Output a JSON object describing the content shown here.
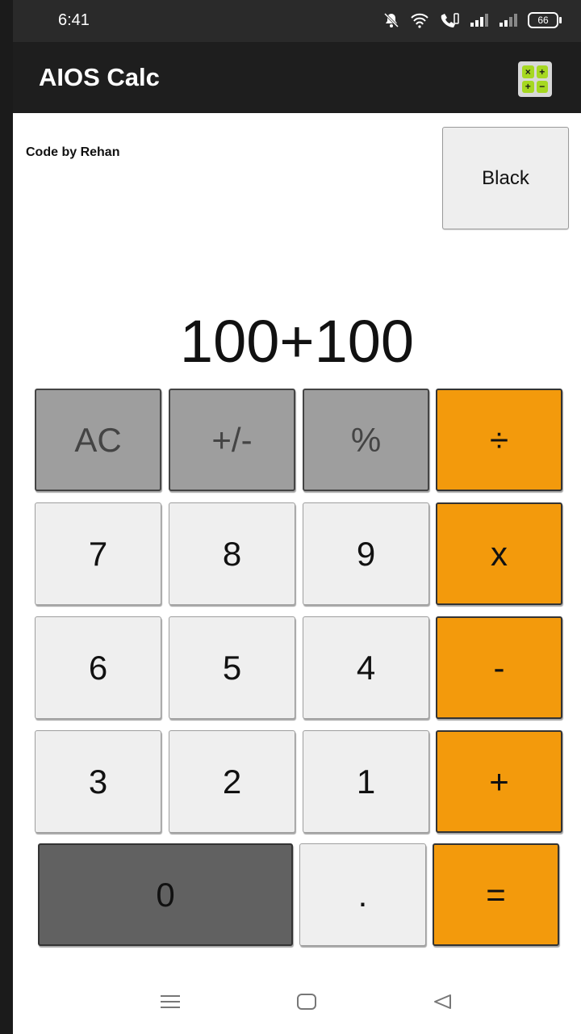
{
  "status_bar": {
    "time": "6:41",
    "battery": "66"
  },
  "app_bar": {
    "title": "AIOS Calc",
    "icon_symbols": [
      "×",
      "+",
      "+",
      "−"
    ]
  },
  "credit": "Code by Rehan",
  "theme_button": "Black",
  "display": "100+100",
  "keys": {
    "ac": "AC",
    "plus_minus": "+/-",
    "percent": "%",
    "divide": "÷",
    "seven": "7",
    "eight": "8",
    "nine": "9",
    "multiply": "x",
    "six": "6",
    "five": "5",
    "four": "4",
    "subtract": "-",
    "three": "3",
    "two": "2",
    "one": "1",
    "add": "+",
    "zero": "0",
    "decimal": ".",
    "equals": "="
  },
  "colors": {
    "function_key": "#9e9e9e",
    "number_key": "#efefef",
    "operator_key": "#f39a0c",
    "zero_key": "#616161",
    "app_bar": "#1e1e1e",
    "icon_green": "#a6d821"
  },
  "nav_icons": [
    "menu-icon",
    "home-icon",
    "back-icon"
  ]
}
